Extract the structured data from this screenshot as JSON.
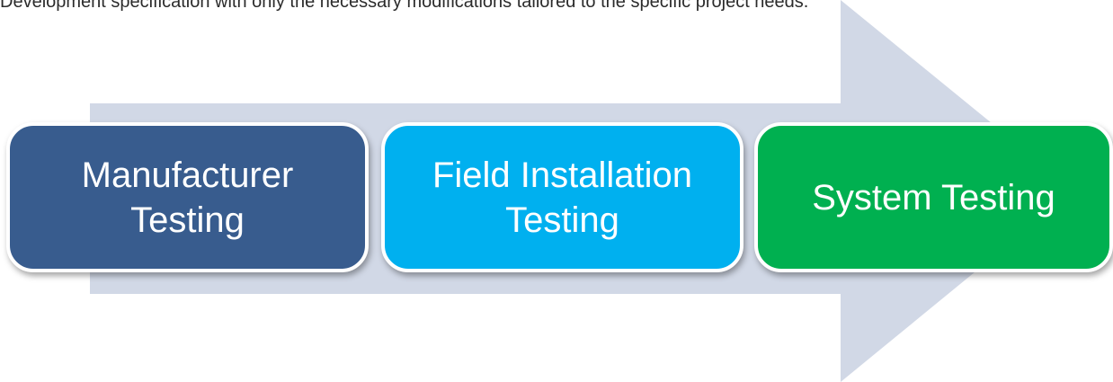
{
  "caption_fragment": "Development specification with only the necessary modifications tailored to the specific project needs.",
  "process_steps": [
    {
      "label": "Manufacturer\nTesting",
      "color": "#385c8e"
    },
    {
      "label": "Field Installation\nTesting",
      "color": "#00b0ef"
    },
    {
      "label": "System Testing",
      "color": "#00b050"
    }
  ],
  "arrow_color": "#d1d8e6",
  "text_color": "#ffffff"
}
